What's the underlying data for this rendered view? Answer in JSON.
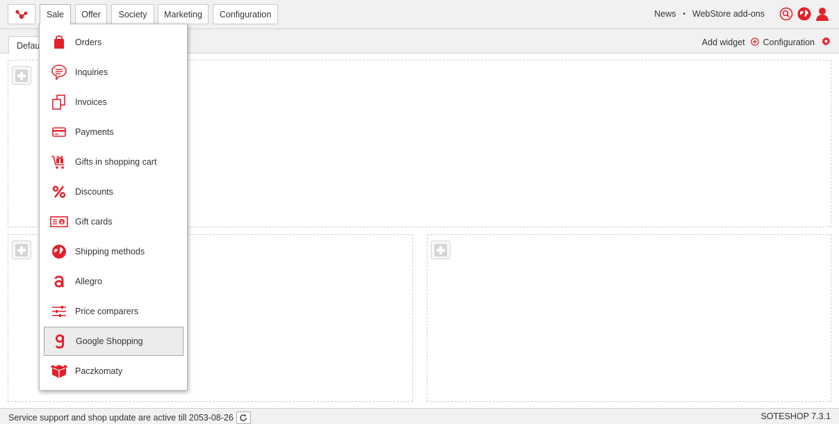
{
  "nav": {
    "items": [
      {
        "label": "Sale",
        "active": true
      },
      {
        "label": "Offer"
      },
      {
        "label": "Society"
      },
      {
        "label": "Marketing"
      },
      {
        "label": "Configuration"
      }
    ],
    "right": {
      "news": "News",
      "separator": "•",
      "addons": "WebStore add-ons"
    },
    "icons": [
      "search-icon",
      "globe-icon",
      "user-icon"
    ]
  },
  "dashboard": {
    "tab_label": "Default",
    "add_widget": "Add widget",
    "configuration": "Configuration"
  },
  "sale_menu": [
    {
      "label": "Orders",
      "icon": "shopping-bag-icon"
    },
    {
      "label": "Inquiries",
      "icon": "chat-bubble-icon"
    },
    {
      "label": "Invoices",
      "icon": "documents-icon"
    },
    {
      "label": "Payments",
      "icon": "credit-card-icon"
    },
    {
      "label": "Gifts in shopping cart",
      "icon": "gift-cart-icon"
    },
    {
      "label": "Discounts",
      "icon": "percent-icon"
    },
    {
      "label": "Gift cards",
      "icon": "gift-card-icon"
    },
    {
      "label": "Shipping methods",
      "icon": "shipping-globe-icon"
    },
    {
      "label": "Allegro",
      "icon": "allegro-icon"
    },
    {
      "label": "Price comparers",
      "icon": "sliders-icon"
    },
    {
      "label": "Google Shopping",
      "icon": "google-shopping-icon",
      "highlighted": true
    },
    {
      "label": "Paczkomaty",
      "icon": "paczkomaty-icon"
    }
  ],
  "footer": {
    "support_text": "Service support and shop update are active till 2053-08-26",
    "version": "SOTESHOP 7.3.1"
  },
  "colors": {
    "accent": "#e3202a",
    "chrome": "#f1f1f1"
  }
}
